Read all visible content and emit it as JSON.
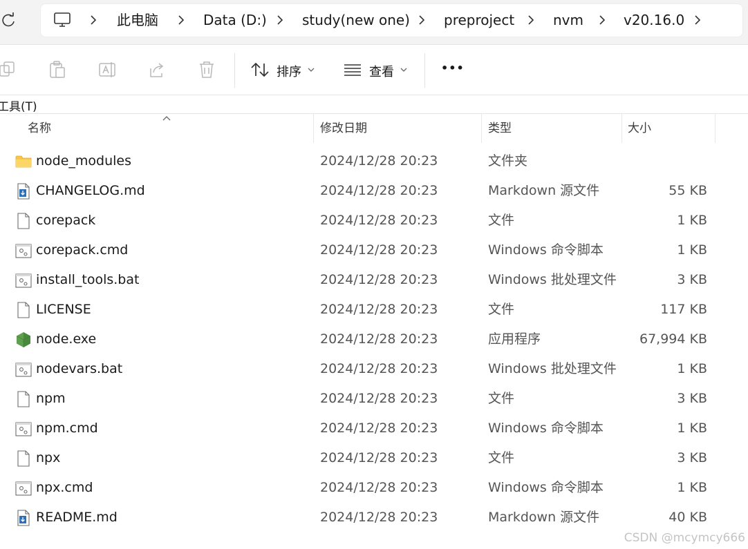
{
  "breadcrumb": {
    "items": [
      "此电脑",
      "Data (D:)",
      "study(new one)",
      "preproject",
      "nvm",
      "v20.16.0"
    ]
  },
  "toolbar": {
    "sort_label": "排序",
    "view_label": "查看",
    "more_label": "•••"
  },
  "menu": {
    "tools_label": "工具(T)"
  },
  "columns": {
    "name": "名称",
    "modified": "修改日期",
    "type": "类型",
    "size": "大小"
  },
  "files": [
    {
      "name": "node_modules",
      "modified": "2024/12/28 20:23",
      "type": "文件夹",
      "size": "",
      "icon": "folder-icon"
    },
    {
      "name": "CHANGELOG.md",
      "modified": "2024/12/28 20:23",
      "type": "Markdown 源文件",
      "size": "55 KB",
      "icon": "markdown-file-icon"
    },
    {
      "name": "corepack",
      "modified": "2024/12/28 20:23",
      "type": "文件",
      "size": "1 KB",
      "icon": "file-icon"
    },
    {
      "name": "corepack.cmd",
      "modified": "2024/12/28 20:23",
      "type": "Windows 命令脚本",
      "size": "1 KB",
      "icon": "script-file-icon"
    },
    {
      "name": "install_tools.bat",
      "modified": "2024/12/28 20:23",
      "type": "Windows 批处理文件",
      "size": "3 KB",
      "icon": "script-file-icon"
    },
    {
      "name": "LICENSE",
      "modified": "2024/12/28 20:23",
      "type": "文件",
      "size": "117 KB",
      "icon": "file-icon"
    },
    {
      "name": "node.exe",
      "modified": "2024/12/28 20:23",
      "type": "应用程序",
      "size": "67,994 KB",
      "icon": "nodejs-icon"
    },
    {
      "name": "nodevars.bat",
      "modified": "2024/12/28 20:23",
      "type": "Windows 批处理文件",
      "size": "1 KB",
      "icon": "script-file-icon"
    },
    {
      "name": "npm",
      "modified": "2024/12/28 20:23",
      "type": "文件",
      "size": "3 KB",
      "icon": "file-icon"
    },
    {
      "name": "npm.cmd",
      "modified": "2024/12/28 20:23",
      "type": "Windows 命令脚本",
      "size": "1 KB",
      "icon": "script-file-icon"
    },
    {
      "name": "npx",
      "modified": "2024/12/28 20:23",
      "type": "文件",
      "size": "3 KB",
      "icon": "file-icon"
    },
    {
      "name": "npx.cmd",
      "modified": "2024/12/28 20:23",
      "type": "Windows 命令脚本",
      "size": "1 KB",
      "icon": "script-file-icon"
    },
    {
      "name": "README.md",
      "modified": "2024/12/28 20:23",
      "type": "Markdown 源文件",
      "size": "40 KB",
      "icon": "markdown-file-icon"
    }
  ],
  "watermark": "CSDN @mcymcy666",
  "colors": {
    "folder": "#f8c74a",
    "node_green": "#5fa04e",
    "markdown_blue": "#2f6fb5"
  }
}
